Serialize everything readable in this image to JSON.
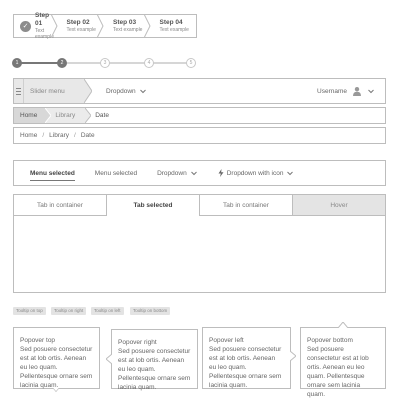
{
  "wizard": {
    "steps": [
      {
        "title": "Step 01",
        "subtitle": "Text example"
      },
      {
        "title": "Step 02",
        "subtitle": "Text example"
      },
      {
        "title": "Step 03",
        "subtitle": "Text example"
      },
      {
        "title": "Step 04",
        "subtitle": "Text example"
      }
    ]
  },
  "stepper": {
    "steps": [
      "1",
      "2",
      "3",
      "4",
      "5"
    ]
  },
  "navbar": {
    "slider_label": "Slider menu",
    "dropdown_label": "Dropdown",
    "username": "Username"
  },
  "breadcrumb_arrow": {
    "items": [
      "Home",
      "Library",
      "Date"
    ]
  },
  "breadcrumb_slash": {
    "items": [
      "Home",
      "Library",
      "Date"
    ],
    "separator": "/"
  },
  "menubar": {
    "items": [
      {
        "label": "Menu selected"
      },
      {
        "label": "Menu selected"
      },
      {
        "label": "Dropdown"
      },
      {
        "label": "Dropdown with icon"
      }
    ]
  },
  "tabs": {
    "items": [
      {
        "label": "Tab in container"
      },
      {
        "label": "Tab selected"
      },
      {
        "label": "Tab in container"
      },
      {
        "label": "Hover"
      }
    ]
  },
  "tooltips": {
    "items": [
      "Tooltip on top",
      "Tooltip on right",
      "Tooltip on left",
      "Tooltip on bottom"
    ]
  },
  "popovers": {
    "items": [
      {
        "title": "Popover top",
        "body": "Sed posuere consectetur est at lob ortis. Aenean eu leo quam. Pellentesque ornare sem lacinia quam."
      },
      {
        "title": "Popover right",
        "body": "Sed posuere consectetur est at lob ortis. Aenean eu leo quam. Pellentesque ornare sem lacinia quam."
      },
      {
        "title": "Popover left",
        "body": "Sed posuere consectetur est at lob ortis. Aenean eu leo quam. Pellentesque ornare sem lacinia quam."
      },
      {
        "title": "Popover bottom",
        "body": "Sed posuere consectetur est at lob ortis. Aenean eu leo quam. Pellentesque ornare sem lacinia quam."
      }
    ]
  },
  "colors": {
    "border": "#bdbdbd",
    "done": "#777777",
    "hover_bg": "#e4e4e4"
  }
}
